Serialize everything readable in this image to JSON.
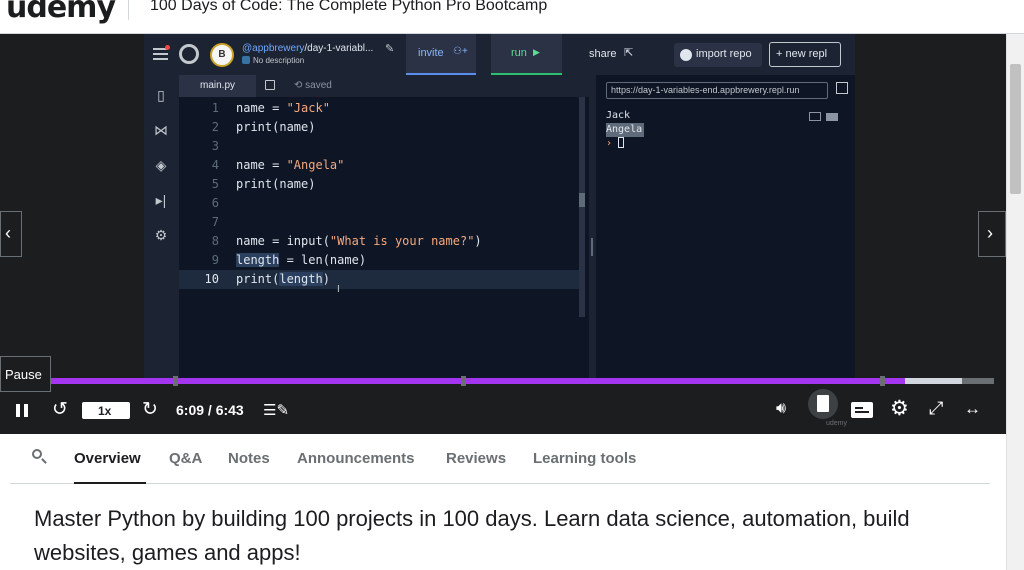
{
  "header": {
    "logo": "udemy",
    "course_title": "100 Days of Code: The Complete Python Pro Bootcamp"
  },
  "replit": {
    "repl_owner": "@appbrewery",
    "repl_name": "/day-1-variabl...",
    "description": "No description",
    "invite_label": "invite",
    "run_label": "run",
    "share_label": "share",
    "import_label": "import repo",
    "new_repl_label": "+ new repl",
    "file_tab": "main.py",
    "saved_label": "saved",
    "code_lines": [
      {
        "n": "1",
        "t": "name = \"Jack\""
      },
      {
        "n": "2",
        "t": "print(name)"
      },
      {
        "n": "3",
        "t": ""
      },
      {
        "n": "4",
        "t": "name = \"Angela\""
      },
      {
        "n": "5",
        "t": "print(name)"
      },
      {
        "n": "6",
        "t": ""
      },
      {
        "n": "7",
        "t": ""
      },
      {
        "n": "8",
        "t": "name = input(\"What is your name?\")"
      },
      {
        "n": "9",
        "t": "length = len(name)"
      },
      {
        "n": "10",
        "t": "print(length)"
      }
    ],
    "url": "https://day-1-variables-end.appbrewery.repl.run",
    "console_lines": [
      "Jack",
      "Angela"
    ]
  },
  "player": {
    "tooltip": "Pause",
    "speed": "1x",
    "time": "6:09 / 6:43",
    "progress": 0.906,
    "buffered": 0.966,
    "watermark": "udemy",
    "accent": "#a435f0"
  },
  "tabs": [
    "Overview",
    "Q&A",
    "Notes",
    "Announcements",
    "Reviews",
    "Learning tools"
  ],
  "active_tab": "Overview",
  "overview_text": "Master Python by building 100 projects in 100 days. Learn data science, automation, build websites, games and apps!"
}
